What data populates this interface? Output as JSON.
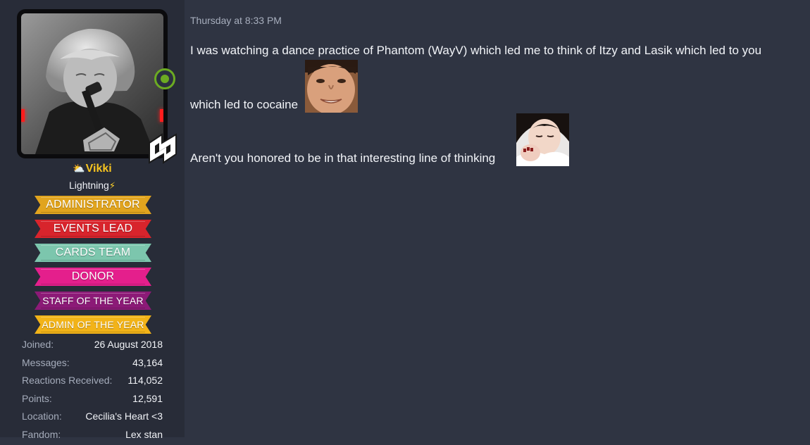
{
  "user": {
    "name": "Vikki",
    "title": "Lightning",
    "banners": [
      {
        "label": "ADMINISTRATOR",
        "color": "#e1a41e"
      },
      {
        "label": "EVENTS LEAD",
        "color": "#d8242c"
      },
      {
        "label": "CARDS TEAM",
        "color": "#7cc6ad"
      },
      {
        "label": "DONOR",
        "color": "#e41f8c"
      },
      {
        "label": "STAFF OF THE YEAR",
        "color": "#8c1a77"
      },
      {
        "label": "ADMIN OF THE YEAR",
        "color": "#f2b318"
      }
    ],
    "stats": [
      {
        "label": "Joined:",
        "value": "26 August 2018"
      },
      {
        "label": "Messages:",
        "value": "43,164"
      },
      {
        "label": "Reactions Received:",
        "value": "114,052"
      },
      {
        "label": "Points:",
        "value": "12,591"
      },
      {
        "label": "Location:",
        "value": "Cecilia's Heart <3"
      },
      {
        "label": "Fandom:",
        "value": "Lex stan"
      }
    ],
    "status": "online",
    "username_color": "#f5c320"
  },
  "post": {
    "timestamp": "Thursday at 8:33 PM",
    "lines": [
      "I was watching a dance practice of Phantom (WayV) which led me to think of Itzy and Lasik which led to you",
      "which led to cocaine",
      "Aren't you honored to be in that interesting line of thinking"
    ]
  }
}
